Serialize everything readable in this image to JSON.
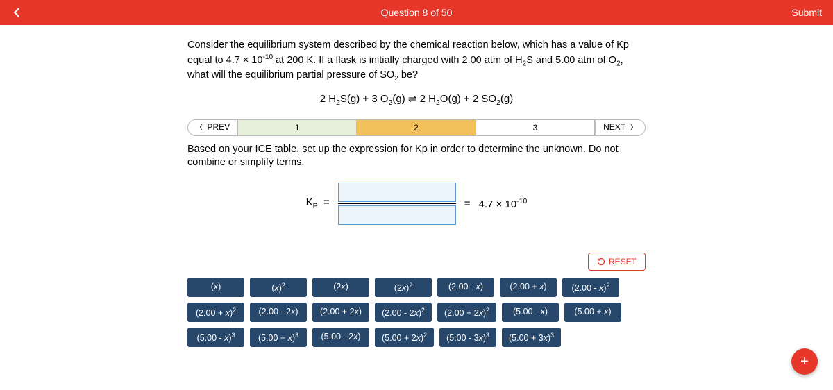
{
  "header": {
    "title": "Question 8 of 50",
    "submit": "Submit"
  },
  "question": {
    "text_html": "Consider the equilibrium system described by the chemical reaction below, which has a value of Kp equal to 4.7 × 10<sup>-10</sup> at 200 K. If a flask is initially charged with 2.00 atm of H<sub>2</sub>S and 5.00 atm of O<sub>2</sub>, what will the equilibrium partial pressure of SO<sub>2</sub> be?",
    "equation_html": "2 H<sub>2</sub>S(g) + 3 O<sub>2</sub>(g) ⇌ 2 H<sub>2</sub>O(g) + 2 SO<sub>2</sub>(g)"
  },
  "stepnav": {
    "prev": "PREV",
    "next": "NEXT",
    "steps": [
      "1",
      "2",
      "3"
    ],
    "active_index": 1
  },
  "instruction": "Based on your ICE table, set up the expression for Kp in order to determine the unknown. Do not combine or simplify terms.",
  "kp": {
    "label_html": "K<sub>P</sub>&nbsp;&nbsp;=",
    "equals": "=",
    "value_html": "4.7 × 10<sup>-10</sup>"
  },
  "reset": "RESET",
  "tiles": [
    "(<i>x</i>)",
    "(<i>x</i>)<sup>2</sup>",
    "(2<i>x</i>)",
    "(2<i>x</i>)<sup>2</sup>",
    "(2.00 - <i>x</i>)",
    "(2.00 + <i>x</i>)",
    "(2.00 - <i>x</i>)<sup>2</sup>",
    "(2.00 + <i>x</i>)<sup>2</sup>",
    "(2.00 - 2<i>x</i>)",
    "(2.00 + 2<i>x</i>)",
    "(2.00 - 2<i>x</i>)<sup>2</sup>",
    "(2.00 + 2<i>x</i>)<sup>2</sup>",
    "(5.00 - <i>x</i>)",
    "(5.00 + <i>x</i>)",
    "(5.00 - <i>x</i>)<sup>3</sup>",
    "(5.00 + <i>x</i>)<sup>3</sup>",
    "(5.00 - 2<i>x</i>)",
    "(5.00 + 2<i>x</i>)<sup>2</sup>",
    "(5.00 - 3<i>x</i>)<sup>3</sup>",
    "(5.00 + 3<i>x</i>)<sup>3</sup>"
  ],
  "fab": "+"
}
